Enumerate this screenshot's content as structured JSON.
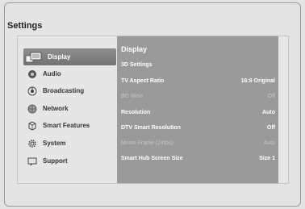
{
  "settings": {
    "title": "Settings",
    "menu": [
      {
        "label": "Display",
        "icon": "display-icon",
        "active": true
      },
      {
        "label": "Audio",
        "icon": "audio-icon"
      },
      {
        "label": "Broadcasting",
        "icon": "broadcasting-icon"
      },
      {
        "label": "Network",
        "icon": "network-icon"
      },
      {
        "label": "Smart Features",
        "icon": "smart-features-icon"
      },
      {
        "label": "System",
        "icon": "gear-icon"
      },
      {
        "label": "Support",
        "icon": "support-icon"
      }
    ],
    "content": {
      "title": "Display",
      "rows": [
        {
          "label": "3D Settings",
          "value": ""
        },
        {
          "label": "TV Aspect Ratio",
          "value": "16:9 Original"
        },
        {
          "label": "BD Wise",
          "value": "Off",
          "disabled": true
        },
        {
          "label": "Resolution",
          "value": "Auto"
        },
        {
          "label": "DTV Smart Resolution",
          "value": "Off"
        },
        {
          "label": "Movie Frame (24fps)",
          "value": "Auto",
          "disabled": true
        },
        {
          "label": "Smart Hub Screen Size",
          "value": "Size 1"
        }
      ]
    }
  }
}
